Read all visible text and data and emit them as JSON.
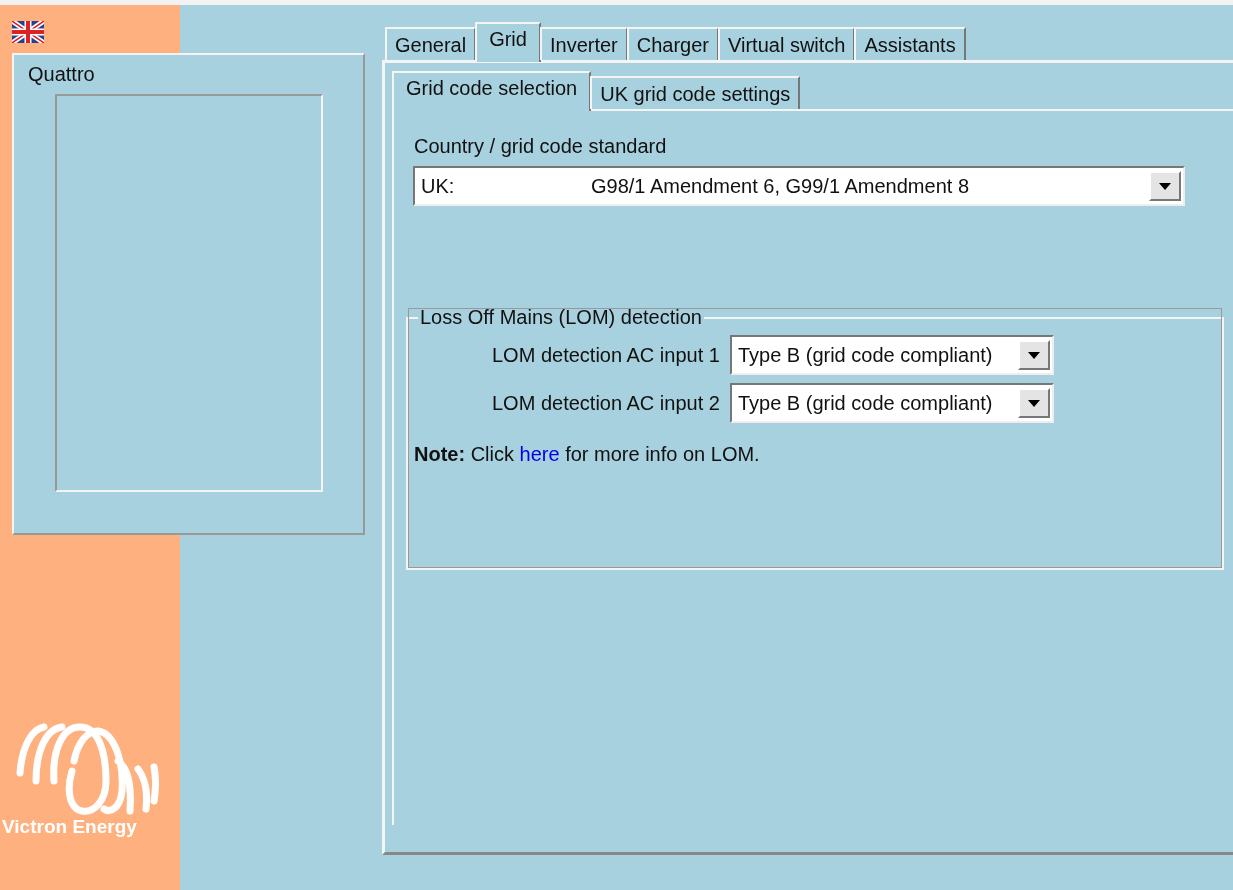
{
  "device": {
    "name": "Quattro"
  },
  "logo": {
    "caption": "Victron Energy"
  },
  "tabs": [
    {
      "label": "General",
      "selected": false
    },
    {
      "label": "Grid",
      "selected": true
    },
    {
      "label": "Inverter",
      "selected": false
    },
    {
      "label": "Charger",
      "selected": false
    },
    {
      "label": "Virtual switch",
      "selected": false
    },
    {
      "label": "Assistants",
      "selected": false
    }
  ],
  "subtabs": [
    {
      "label": "Grid code selection",
      "selected": true
    },
    {
      "label": "UK grid code settings",
      "selected": false
    }
  ],
  "grid_code": {
    "label": "Country / grid code standard",
    "country": "UK:",
    "standard": "G98/1 Amendment 6,  G99/1 Amendment 8"
  },
  "lom": {
    "title": "Loss Off Mains (LOM) detection",
    "rows": [
      {
        "label": "LOM detection AC input 1",
        "value": "Type B (grid code compliant)"
      },
      {
        "label": "LOM detection AC input 2",
        "value": "Type B (grid code compliant)"
      }
    ],
    "note": {
      "prefix": "**Note:** Click ",
      "link": "here",
      "suffix": " for more info on LOM."
    }
  }
}
